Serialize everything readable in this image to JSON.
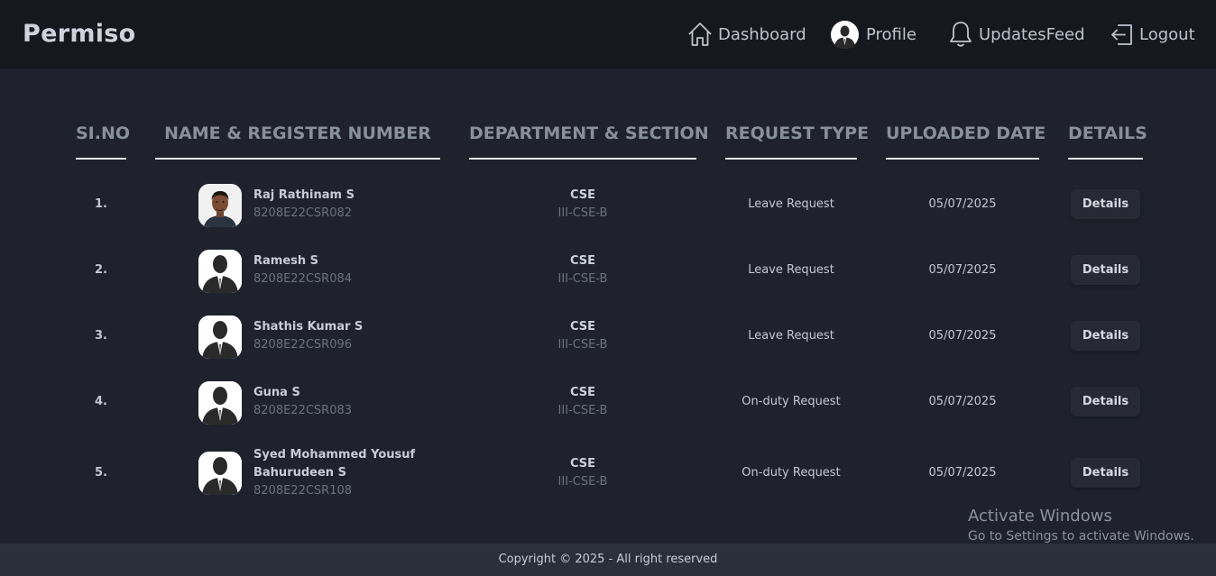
{
  "app": {
    "brand": "Permiso"
  },
  "nav": {
    "dashboard": "Dashboard",
    "profile": "Profile",
    "updates": "UpdatesFeed",
    "logout": "Logout"
  },
  "table": {
    "headers": [
      "SI.NO",
      "NAME & REGISTER NUMBER",
      "DEPARTMENT & SECTION",
      "REQUEST TYPE",
      "UPLOADED DATE",
      "DETAILS"
    ],
    "rows": [
      {
        "no": "1.",
        "name": "Raj Rathinam S",
        "reg": "8208E22CSR082",
        "dept": "CSE",
        "section": "III-CSE-B",
        "request": "Leave Request",
        "date": "05/07/2025",
        "action": "Details",
        "avatar": "photo"
      },
      {
        "no": "2.",
        "name": "Ramesh S",
        "reg": "8208E22CSR084",
        "dept": "CSE",
        "section": "III-CSE-B",
        "request": "Leave Request",
        "date": "05/07/2025",
        "action": "Details",
        "avatar": "silhouette"
      },
      {
        "no": "3.",
        "name": "Shathis Kumar S",
        "reg": "8208E22CSR096",
        "dept": "CSE",
        "section": "III-CSE-B",
        "request": "Leave Request",
        "date": "05/07/2025",
        "action": "Details",
        "avatar": "silhouette"
      },
      {
        "no": "4.",
        "name": "Guna S",
        "reg": "8208E22CSR083",
        "dept": "CSE",
        "section": "III-CSE-B",
        "request": "On-duty Request",
        "date": "05/07/2025",
        "action": "Details",
        "avatar": "silhouette"
      },
      {
        "no": "5.",
        "name": "Syed Mohammed Yousuf Bahurudeen S",
        "reg": "8208E22CSR108",
        "dept": "CSE",
        "section": "III-CSE-B",
        "request": "On-duty Request",
        "date": "05/07/2025",
        "action": "Details",
        "avatar": "silhouette"
      }
    ]
  },
  "watermark": {
    "title": "Activate Windows",
    "subtitle": "Go to Settings to activate Windows."
  },
  "footer": {
    "copyright": "Copyright © 2025 - All right reserved"
  },
  "colors": {
    "background": "#1f222d",
    "topbar": "#16181f",
    "footer": "#2b2f3c",
    "header_text": "#8a8f9c"
  }
}
